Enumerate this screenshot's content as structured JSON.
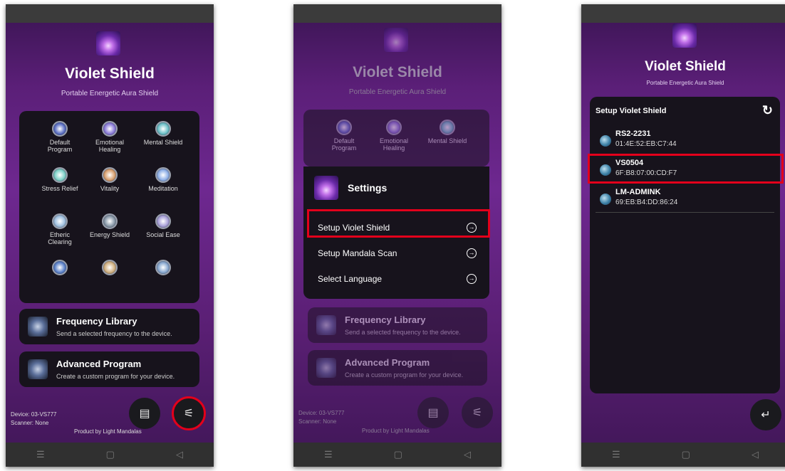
{
  "app": {
    "title": "Violet Shield",
    "subtitle": "Portable Energetic Aura Shield"
  },
  "programs": [
    {
      "label": "Default\nProgram",
      "color": "#5a6ec2"
    },
    {
      "label": "Emotional\nHealing",
      "color": "#8a7bd8"
    },
    {
      "label": "Mental Shield",
      "color": "#6cc0c8"
    },
    {
      "label": "Stress Relief",
      "color": "#7ed0c8"
    },
    {
      "label": "Vitality",
      "color": "#d8a070"
    },
    {
      "label": "Meditation",
      "color": "#8fb0e8"
    },
    {
      "label": "Etheric\nClearing",
      "color": "#9fc0e0"
    },
    {
      "label": "Energy Shield",
      "color": "#8898a8"
    },
    {
      "label": "Social Ease",
      "color": "#a8a0d8"
    },
    {
      "label": "",
      "color": "#5a80c8"
    },
    {
      "label": "",
      "color": "#d0b080"
    },
    {
      "label": "",
      "color": "#88a8d0"
    }
  ],
  "library": {
    "title": "Frequency Library",
    "sub": "Send a selected frequency to the device."
  },
  "advanced": {
    "title": "Advanced Program",
    "sub": "Create a custom program for your device."
  },
  "footer": {
    "device": "Device: 03-VS777",
    "scanner": "Scanner: None",
    "credit": "Product by Light Mandalas"
  },
  "settings": {
    "title": "Settings",
    "items": [
      "Setup Violet Shield",
      "Setup Mandala Scan",
      "Select Language"
    ]
  },
  "setup": {
    "title": "Setup Violet Shield",
    "devices": [
      {
        "name": "RS2-2231",
        "mac": "01:4E:52:EB:C7:44"
      },
      {
        "name": "VS0504",
        "mac": "6F:B8:07:00:CD:F7"
      },
      {
        "name": "LM-ADMINK",
        "mac": "69:EB:B4:DD:86:24"
      }
    ]
  },
  "icons": {
    "store": "store-icon",
    "settings": "sliders-icon",
    "refresh": "refresh-icon",
    "back": "return-icon"
  },
  "colors": {
    "highlight": "#e3001b",
    "card": "#17131c",
    "accent": "#6e2890"
  }
}
